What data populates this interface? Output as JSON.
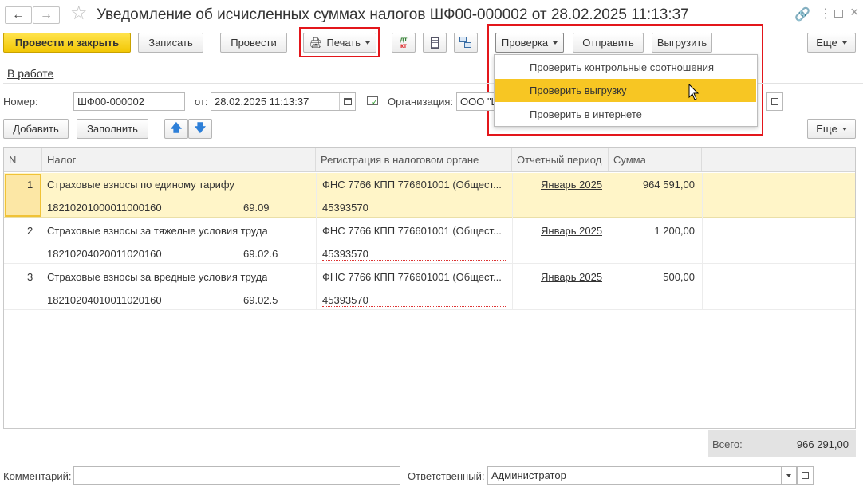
{
  "window": {
    "title": "Уведомление об исчисленных суммах налогов ШФ00-000002 от 28.02.2025 11:13:37"
  },
  "toolbar": {
    "post_close": "Провести и закрыть",
    "save": "Записать",
    "post": "Провести",
    "print": "Печать",
    "check": "Проверка",
    "send": "Отправить",
    "export": "Выгрузить",
    "more": "Еще"
  },
  "check_menu": {
    "items": [
      "Проверить контрольные соотношения",
      "Проверить выгрузку",
      "Проверить в интернете"
    ]
  },
  "status_link": "В работе",
  "form": {
    "number_label": "Номер:",
    "number_value": "ШФ00-000002",
    "date_label": "от:",
    "date_value": "28.02.2025 11:13:37",
    "org_label": "Организация:",
    "org_value": "ООО \"Ш"
  },
  "table_toolbar": {
    "add": "Добавить",
    "fill": "Заполнить",
    "more": "Еще"
  },
  "table": {
    "headers": [
      "N",
      "Налог",
      "Регистрация в налоговом органе",
      "Отчетный период",
      "Сумма"
    ],
    "rows": [
      {
        "n": "1",
        "tax": "Страховые взносы по единому тарифу",
        "kbk": "18210201000011000160",
        "account": "69.09",
        "reg": "ФНС 7766 КПП 776601001 (Общест...",
        "oktmo": "45393570",
        "period": "Январь 2025",
        "sum": "964 591,00"
      },
      {
        "n": "2",
        "tax": "Страховые взносы за тяжелые условия труда",
        "kbk": "18210204020011020160",
        "account": "69.02.6",
        "reg": "ФНС 7766 КПП 776601001 (Общест...",
        "oktmo": "45393570",
        "period": "Январь 2025",
        "sum": "1 200,00"
      },
      {
        "n": "3",
        "tax": "Страховые взносы за вредные условия труда",
        "kbk": "18210204010011020160",
        "account": "69.02.5",
        "reg": "ФНС 7766 КПП 776601001 (Общест...",
        "oktmo": "45393570",
        "period": "Январь 2025",
        "sum": "500,00"
      }
    ]
  },
  "total": {
    "label": "Всего:",
    "value": "966 291,00"
  },
  "footer": {
    "comment_label": "Комментарий:",
    "comment_value": "",
    "responsible_label": "Ответственный:",
    "responsible_value": "Администратор"
  },
  "colors": {
    "primary_button": "#f2c705",
    "selected_row": "#fff5c8",
    "menu_highlight": "#f7c623",
    "annotation_red": "#e3161b"
  }
}
